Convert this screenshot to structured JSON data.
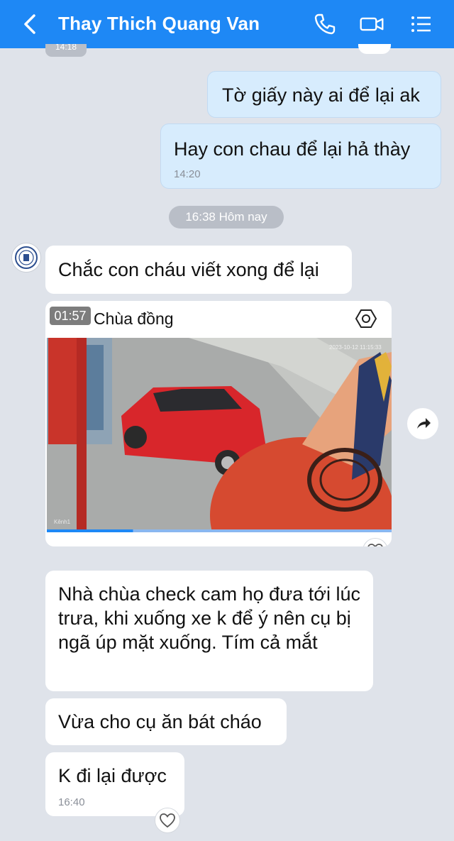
{
  "header": {
    "title": "Thay Thich Quang Van",
    "icons": [
      "back-arrow-icon",
      "phone-icon",
      "video-call-icon",
      "menu-list-icon"
    ],
    "background": "#1e88f5"
  },
  "conversation": {
    "partial_timestamp": "14:18",
    "messages_sent": [
      {
        "text": "Tờ giấy này ai để lại ak"
      },
      {
        "text": "Hay con chau để lại hả thày",
        "time": "14:20"
      }
    ],
    "date_separator": "16:38 Hôm nay",
    "messages_received": [
      {
        "text": "Chắc con cháu viết xong để lại"
      },
      {
        "text": "Nhà chùa check cam họ đưa tới lúc trưa, khi xuống xe k để ý nên cụ bị ngã úp mặt xuống. Tím cả mắt"
      },
      {
        "text": "Vừa cho cụ ăn bát cháo"
      },
      {
        "text": "K đi lại được",
        "time": "16:40"
      }
    ],
    "video": {
      "duration": "01:57",
      "title": "Chùa đồng",
      "cam_label": "Kênh1",
      "cam_timestamp": "2023-10-12 11:15:33",
      "progress": 0.25
    }
  },
  "colors": {
    "sent_bubble": "#d7ecfd",
    "received_bubble": "#ffffff",
    "background": "#dfe3ea"
  }
}
